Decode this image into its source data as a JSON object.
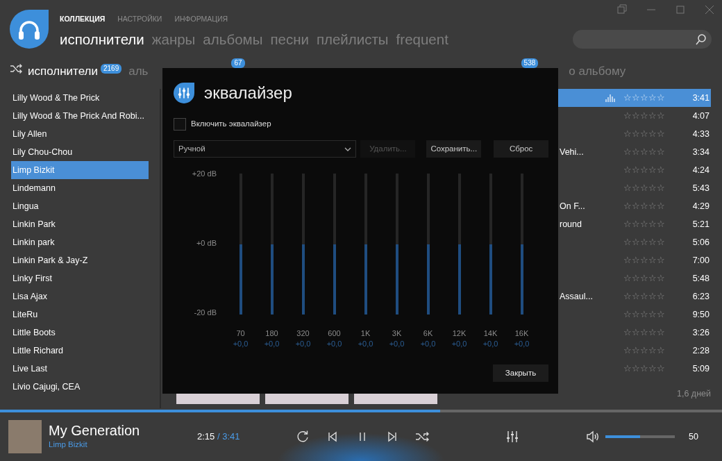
{
  "top_nav": [
    {
      "label": "КОЛЛЕКЦИЯ",
      "selected": true
    },
    {
      "label": "НАСТРОЙКИ",
      "selected": false
    },
    {
      "label": "ИНФОРМАЦИЯ",
      "selected": false
    }
  ],
  "tabs": [
    {
      "label": "исполнители",
      "selected": true
    },
    {
      "label": "жанры",
      "selected": false
    },
    {
      "label": "альбомы",
      "selected": false
    },
    {
      "label": "песни",
      "selected": false
    },
    {
      "label": "плейлисты",
      "selected": false
    },
    {
      "label": "frequent",
      "selected": false
    }
  ],
  "sub_tabs": [
    {
      "label": "исполнители",
      "count": "2169",
      "selected": true
    },
    {
      "label": "аль",
      "count": "67",
      "selected": false
    },
    {
      "count": "538",
      "selected": false
    }
  ],
  "sort_label": "о альбому",
  "artists": [
    {
      "name": "Lilly Wood & The Prick",
      "selected": false
    },
    {
      "name": "Lilly Wood & The Prick And Robi...",
      "selected": false
    },
    {
      "name": "Lily Allen",
      "selected": false
    },
    {
      "name": "Lily Chou-Chou",
      "selected": false
    },
    {
      "name": "Limp Bizkit",
      "selected": true
    },
    {
      "name": "Lindemann",
      "selected": false
    },
    {
      "name": "Lingua",
      "selected": false
    },
    {
      "name": "Linkin Park",
      "selected": false
    },
    {
      "name": "Linkin park",
      "selected": false
    },
    {
      "name": "Linkin Park & Jay-Z",
      "selected": false
    },
    {
      "name": "Linky First",
      "selected": false
    },
    {
      "name": "Lisa Ajax",
      "selected": false
    },
    {
      "name": "LiteRu",
      "selected": false
    },
    {
      "name": "Little Boots",
      "selected": false
    },
    {
      "name": "Little Richard",
      "selected": false
    },
    {
      "name": "Live Last",
      "selected": false
    },
    {
      "name": "Livio Cajugi, CEA",
      "selected": false
    }
  ],
  "tracks": [
    {
      "selected": true,
      "playing": true,
      "stars": 0,
      "time": "3:41"
    },
    {
      "selected": false,
      "playing": false,
      "stars": 0,
      "time": "4:07"
    },
    {
      "selected": false,
      "playing": false,
      "stars": 0,
      "time": "4:33"
    },
    {
      "title": "Vehi...",
      "selected": false,
      "playing": false,
      "stars": 0,
      "time": "3:34"
    },
    {
      "selected": false,
      "playing": false,
      "stars": 0,
      "time": "4:24"
    },
    {
      "selected": false,
      "playing": false,
      "stars": 0,
      "time": "5:43"
    },
    {
      "title": "On F...",
      "selected": false,
      "playing": false,
      "stars": 0,
      "time": "4:29"
    },
    {
      "title": "round",
      "selected": false,
      "playing": false,
      "stars": 0,
      "time": "5:21"
    },
    {
      "selected": false,
      "playing": false,
      "stars": 0,
      "time": "5:06"
    },
    {
      "selected": false,
      "playing": false,
      "stars": 0,
      "time": "7:00"
    },
    {
      "selected": false,
      "playing": false,
      "stars": 0,
      "time": "5:48"
    },
    {
      "title": "Assaul...",
      "selected": false,
      "playing": false,
      "stars": 0,
      "time": "6:23"
    },
    {
      "selected": false,
      "playing": false,
      "stars": 0,
      "time": "9:50"
    },
    {
      "selected": false,
      "playing": false,
      "stars": 0,
      "time": "3:26"
    },
    {
      "selected": false,
      "playing": false,
      "stars": 0,
      "time": "2:28"
    },
    {
      "selected": false,
      "playing": false,
      "stars": 0,
      "time": "5:09"
    }
  ],
  "list_footer": "1,6 дней",
  "equalizer": {
    "title": "эквалайзер",
    "enable_label": "Включить эквалайзер",
    "checked": false,
    "preset": "Ручной",
    "buttons": [
      {
        "label": "Удалить...",
        "disabled": true
      },
      {
        "label": "Сохранить...",
        "disabled": false
      },
      {
        "label": "Сброс",
        "disabled": false
      }
    ],
    "scale": [
      "+20 dB",
      "+0 dB",
      "-20 dB"
    ],
    "bands": [
      {
        "freq": "70",
        "value": "+0,0",
        "level": 0.5
      },
      {
        "freq": "180",
        "value": "+0,0",
        "level": 0.5
      },
      {
        "freq": "320",
        "value": "+0,0",
        "level": 0.5
      },
      {
        "freq": "600",
        "value": "+0,0",
        "level": 0.5
      },
      {
        "freq": "1K",
        "value": "+0,0",
        "level": 0.5
      },
      {
        "freq": "3K",
        "value": "+0,0",
        "level": 0.5
      },
      {
        "freq": "6K",
        "value": "+0,0",
        "level": 0.5
      },
      {
        "freq": "12K",
        "value": "+0,0",
        "level": 0.5
      },
      {
        "freq": "14K",
        "value": "+0,0",
        "level": 0.5
      },
      {
        "freq": "16K",
        "value": "+0,0",
        "level": 0.5
      }
    ],
    "close_label": "Закрыть"
  },
  "player": {
    "progress": {
      "level": 0.61
    },
    "title": "My Generation",
    "artist": "Limp Bizkit",
    "elapsed": "2:15",
    "total": "/ 3:41",
    "volume": {
      "level": 0.5
    },
    "volume_reading": "50"
  }
}
